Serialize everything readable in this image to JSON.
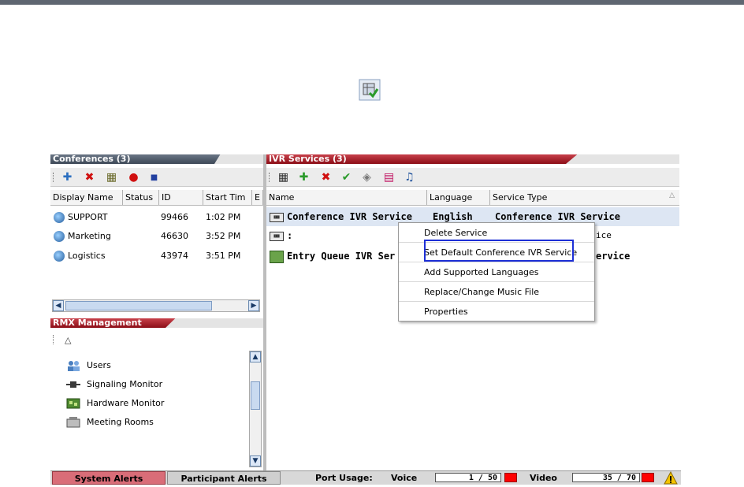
{
  "conferences_panel": {
    "title": "Conferences (3)",
    "columns": [
      "Display Name",
      "Status",
      "ID",
      "Start Tim",
      "E"
    ],
    "rows": [
      {
        "name": "SUPPORT",
        "status": "",
        "id": "99466",
        "start": "1:02 PM"
      },
      {
        "name": "Marketing",
        "status": "",
        "id": "46630",
        "start": "3:52 PM"
      },
      {
        "name": "Logistics",
        "status": "",
        "id": "43974",
        "start": "3:51 PM"
      }
    ]
  },
  "ivr_panel": {
    "title": "IVR Services (3)",
    "columns": [
      "Name",
      "Language",
      "Service Type"
    ],
    "rows": [
      {
        "name": "Conference IVR Service",
        "language": "English",
        "type": "Conference IVR Service"
      },
      {
        "name": ":",
        "language": "",
        "type": "ice"
      },
      {
        "name": "Entry Queue IVR Ser",
        "language": "",
        "type": "ervice"
      }
    ]
  },
  "context_menu": {
    "items": [
      "Delete Service",
      "Set Default Conference IVR Service",
      "Add Supported Languages",
      "Replace/Change Music File",
      "Properties"
    ]
  },
  "rmx_panel": {
    "title": "RMX Management",
    "items": [
      {
        "label": "Users",
        "icon": "users-icon"
      },
      {
        "label": "Signaling Monitor",
        "icon": "signaling-monitor-icon"
      },
      {
        "label": "Hardware Monitor",
        "icon": "hardware-monitor-icon"
      },
      {
        "label": "Meeting Rooms",
        "icon": "meeting-rooms-icon"
      }
    ]
  },
  "status_bar": {
    "system_alerts": "System Alerts",
    "participant_alerts": "Participant Alerts",
    "port_usage": "Port Usage:",
    "voice_label": "Voice",
    "voice_value": "1 / 50",
    "video_label": "Video",
    "video_value": "35 / 70"
  },
  "colors": {
    "accent_red": "#8c0e17",
    "highlight_box": "#1d2fd6",
    "row_selected": "#dde6f3"
  }
}
